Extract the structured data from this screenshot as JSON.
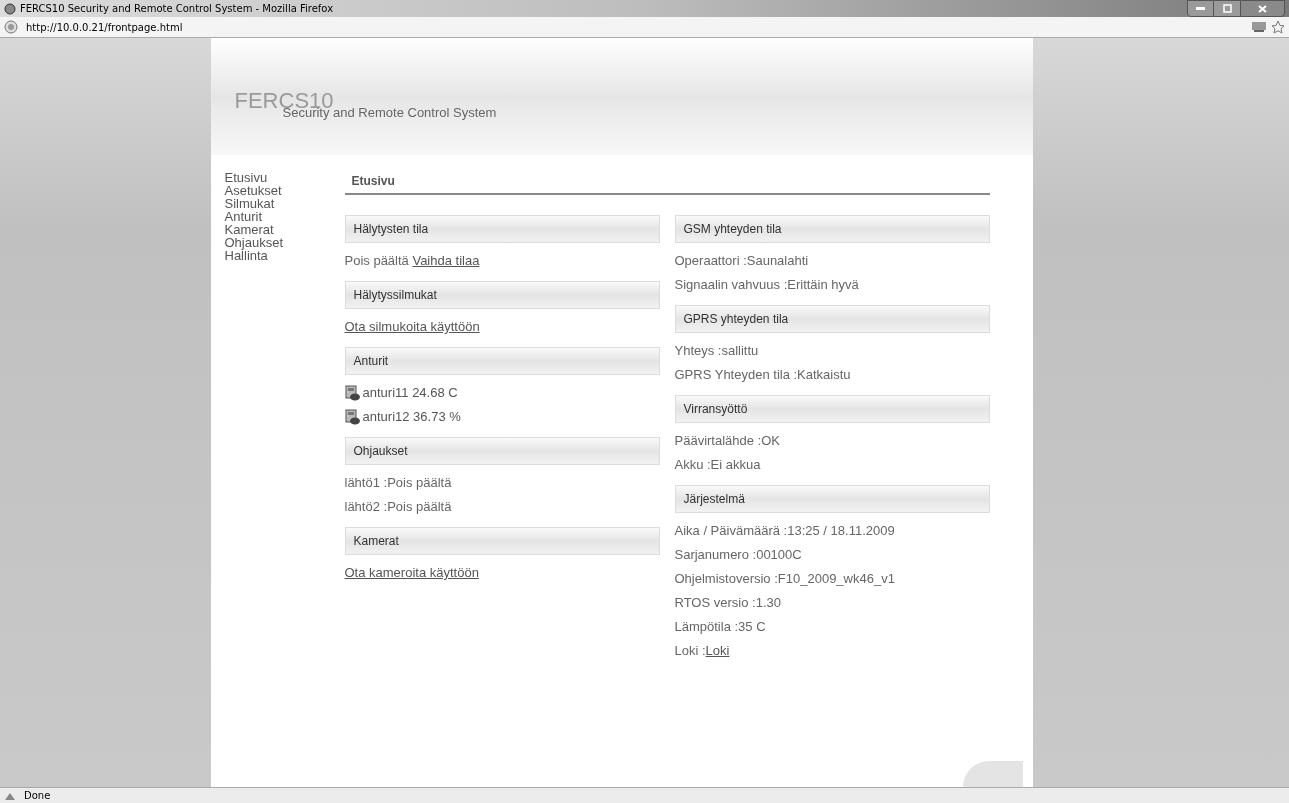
{
  "window": {
    "title": "FERCS10 Security and Remote Control System - Mozilla Firefox"
  },
  "address_bar": {
    "url": "http://10.0.0.21/frontpage.html"
  },
  "header": {
    "logo": "FERCS10",
    "subtitle": "Security and Remote Control System"
  },
  "sidebar": {
    "items": [
      "Etusivu",
      "Asetukset",
      "Silmukat",
      "Anturit",
      "Kamerat",
      "Ohjaukset",
      "Hallinta"
    ]
  },
  "page_heading": "Etusivu",
  "left_sections": [
    {
      "title": "Hälytysten tila",
      "lines": [
        {
          "kind": "text",
          "text": "Pois päältä ",
          "link": "Vaihda tilaa"
        }
      ]
    },
    {
      "title": "Hälytyssilmukat",
      "lines": [
        {
          "kind": "link",
          "text": "Ota silmukoita käyttöön"
        }
      ]
    },
    {
      "title": "Anturit",
      "lines": [
        {
          "kind": "sensor",
          "text": "anturi11 24.68 C"
        },
        {
          "kind": "sensor",
          "text": "anturi12 36.73 %"
        }
      ]
    },
    {
      "title": "Ohjaukset",
      "lines": [
        {
          "kind": "text",
          "text": "lähtö1 :Pois päältä"
        },
        {
          "kind": "text",
          "text": "lähtö2 :Pois päältä"
        }
      ]
    },
    {
      "title": "Kamerat",
      "lines": [
        {
          "kind": "link",
          "text": "Ota kameroita käyttöön"
        }
      ]
    }
  ],
  "right_sections": [
    {
      "title": "GSM yhteyden tila",
      "lines": [
        {
          "kind": "text",
          "text": "Operaattori :Saunalahti"
        },
        {
          "kind": "text",
          "text": "Signaalin vahvuus :Erittäin hyvä"
        }
      ]
    },
    {
      "title": "GPRS yhteyden tila",
      "lines": [
        {
          "kind": "text",
          "text": "Yhteys :sallittu"
        },
        {
          "kind": "text",
          "text": "GPRS Yhteyden tila :Katkaistu"
        }
      ]
    },
    {
      "title": "Virransyöttö",
      "lines": [
        {
          "kind": "text",
          "text": "Päävirtalähde :OK"
        },
        {
          "kind": "text",
          "text": "Akku :Ei akkua"
        }
      ]
    },
    {
      "title": "Järjestelmä",
      "lines": [
        {
          "kind": "text",
          "text": "Aika / Päivämäärä :13:25 / 18.11.2009"
        },
        {
          "kind": "text",
          "text": "Sarjanumero :00100C"
        },
        {
          "kind": "text",
          "text": "Ohjelmistoversio :F10_2009_wk46_v1"
        },
        {
          "kind": "text",
          "text": "RTOS versio :1.30"
        },
        {
          "kind": "text",
          "text": "Lämpötila :35 C"
        },
        {
          "kind": "text",
          "text": "Loki :",
          "link": "Loki"
        }
      ]
    }
  ],
  "status_bar": {
    "text": "Done"
  }
}
